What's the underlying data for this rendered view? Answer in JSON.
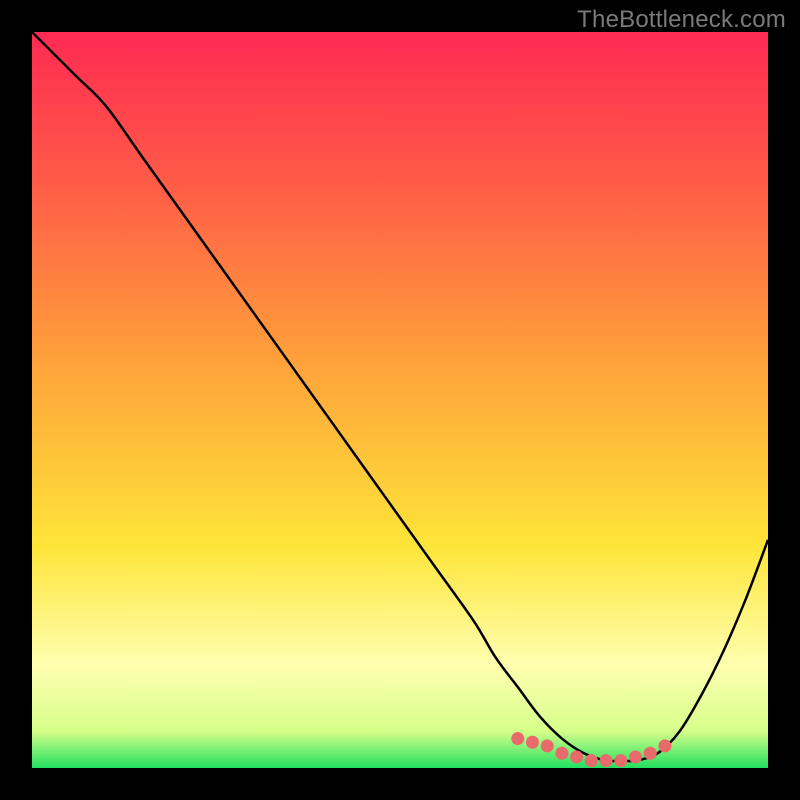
{
  "watermark": "TheBottleneck.com",
  "colors": {
    "background_frame": "#000000",
    "gradient_top": "#ff2a52",
    "gradient_mid_orange": "#ff8a3a",
    "gradient_yellow": "#fff23a",
    "gradient_pale": "#ffffb0",
    "gradient_green": "#22e060",
    "curve": "#000000",
    "dots": "#e86a6a"
  },
  "chart_data": {
    "type": "line",
    "title": "",
    "xlabel": "",
    "ylabel": "",
    "xlim": [
      0,
      100
    ],
    "ylim": [
      0,
      100
    ],
    "grid": false,
    "legend": false,
    "series": [
      {
        "name": "bottleneck-curve",
        "x": [
          0,
          3,
          6,
          10,
          15,
          20,
          25,
          30,
          35,
          40,
          45,
          50,
          55,
          60,
          63,
          66,
          69,
          72,
          75,
          78,
          80,
          82,
          85,
          88,
          91,
          94,
          97,
          100
        ],
        "y": [
          100,
          97,
          94,
          90,
          83,
          76,
          69,
          62,
          55,
          48,
          41,
          34,
          27,
          20,
          15,
          11,
          7,
          4,
          2,
          1,
          1,
          1,
          2,
          5,
          10,
          16,
          23,
          31
        ]
      }
    ],
    "highlight_dots": {
      "name": "optimal-range",
      "x": [
        66,
        68,
        70,
        72,
        74,
        76,
        78,
        80,
        82,
        84,
        86
      ],
      "y": [
        4,
        3.5,
        3,
        2,
        1.5,
        1,
        1,
        1,
        1.5,
        2,
        3
      ]
    },
    "background_gradient": {
      "direction": "vertical",
      "stops": [
        {
          "pos": 0.0,
          "color": "#ff2a52"
        },
        {
          "pos": 0.2,
          "color": "#ff5a48"
        },
        {
          "pos": 0.45,
          "color": "#ffa23a"
        },
        {
          "pos": 0.7,
          "color": "#ffe53a"
        },
        {
          "pos": 0.86,
          "color": "#ffffb0"
        },
        {
          "pos": 0.95,
          "color": "#d6ff8a"
        },
        {
          "pos": 1.0,
          "color": "#22e060"
        }
      ]
    }
  }
}
